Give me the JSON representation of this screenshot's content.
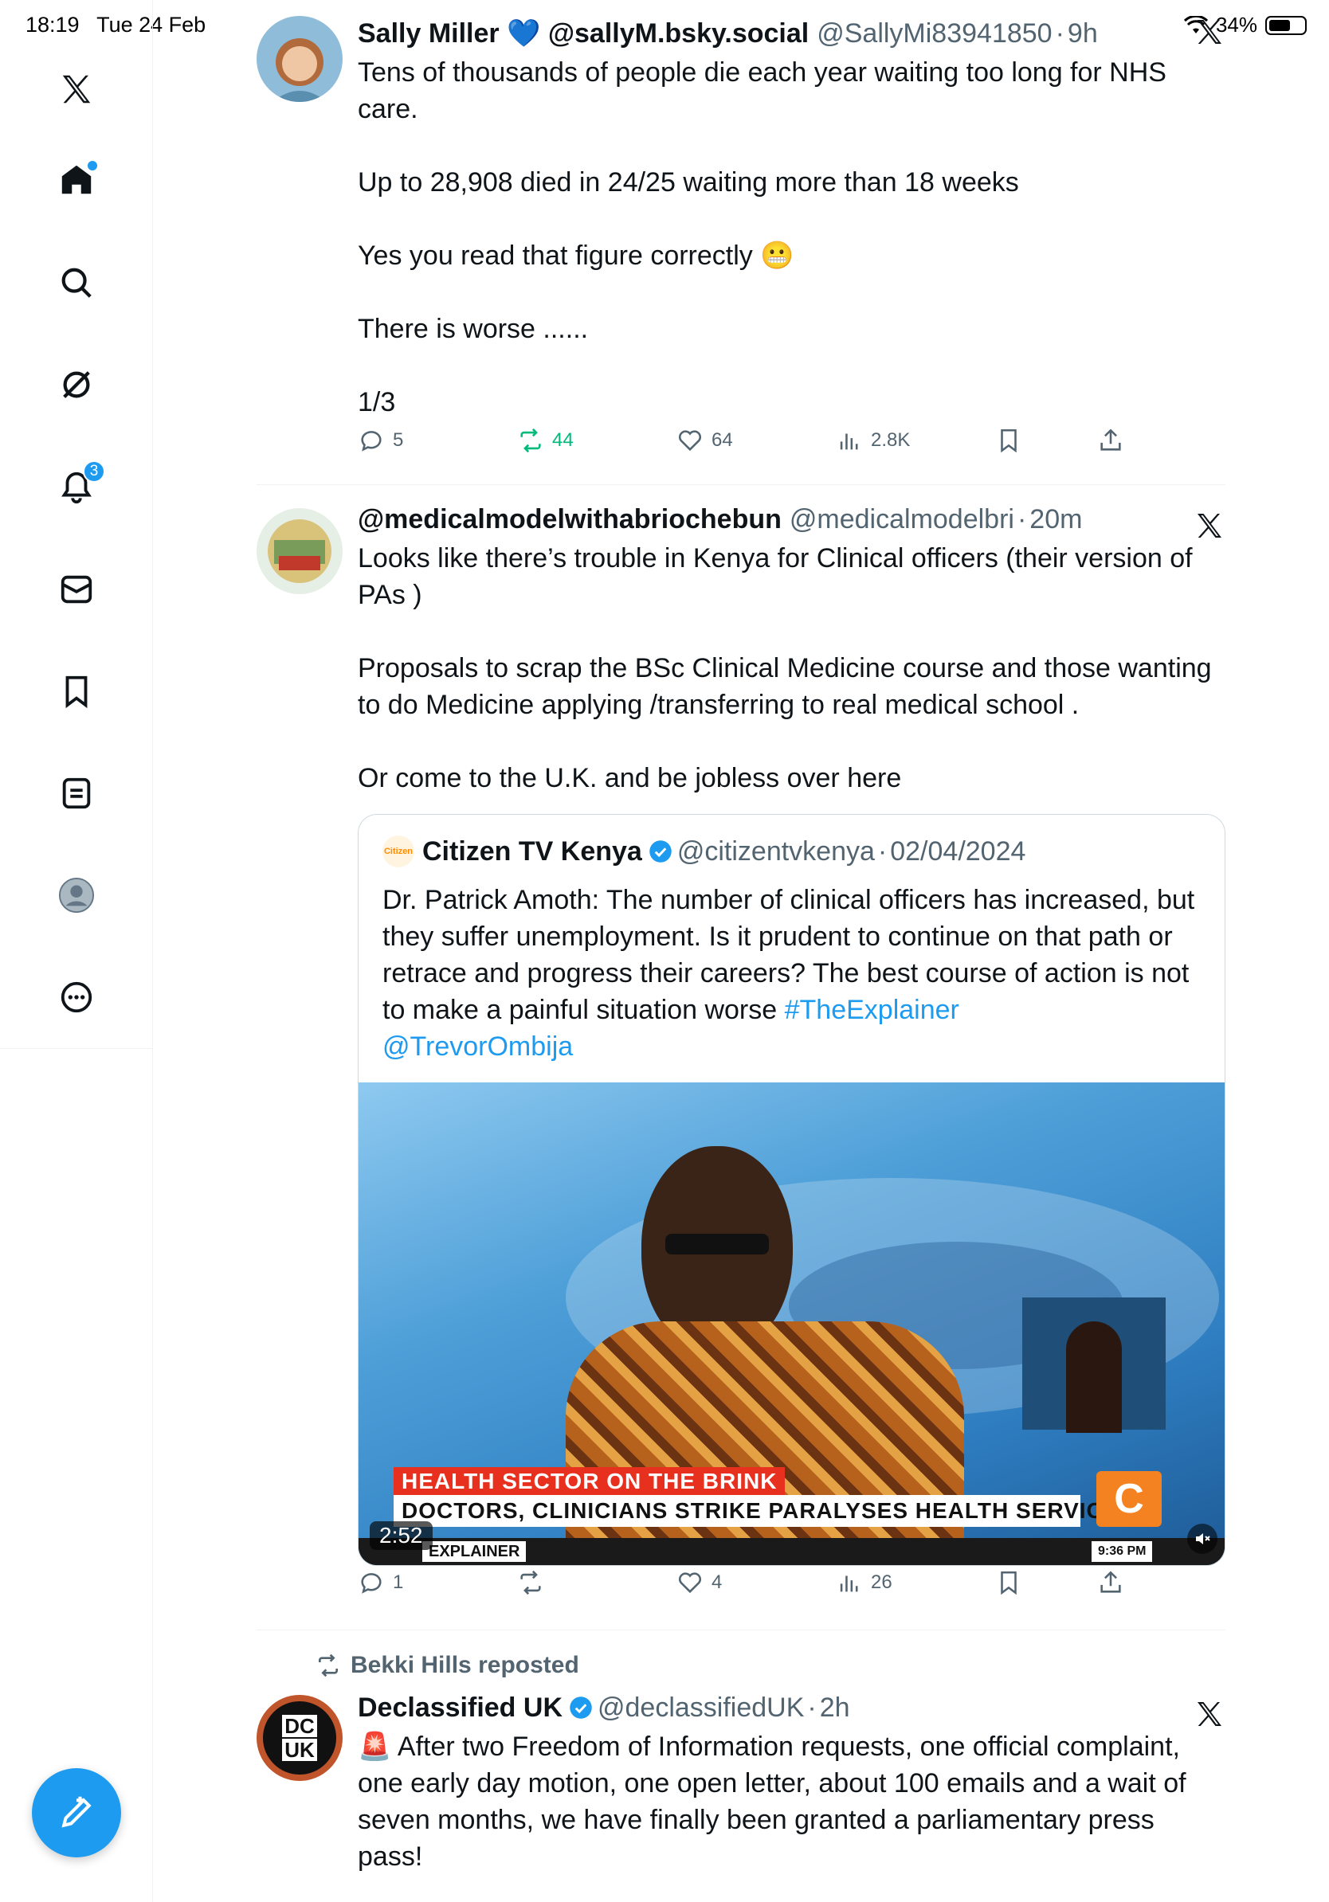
{
  "status_bar": {
    "time": "18:19",
    "date": "Tue 24 Feb",
    "battery": "34%"
  },
  "sidebar": {
    "notifications_count": "3",
    "items": [
      "home",
      "explore",
      "grok",
      "notifications",
      "messages",
      "bookmarks",
      "lists",
      "profile",
      "more"
    ]
  },
  "tweets": [
    {
      "name": "Sally Miller 💙 @sallyM.bsky.social",
      "handle": "@SallyMi83941850",
      "sep": "·",
      "time": "9h",
      "text": "Tens of thousands of people die each year waiting too long for NHS care.\n\nUp to 28,908 died in 24/25 waiting more than 18 weeks\n\nYes you read that figure correctly 😬\n\nThere is worse ......\n\n1/3",
      "replies": "5",
      "reposts": "44",
      "likes": "64",
      "views": "2.8K"
    },
    {
      "name": "@medicalmodelwithabriochebun",
      "handle": "@medicalmodelbri",
      "sep": "·",
      "time": "20m",
      "text": "Looks like there’s trouble in Kenya for Clinical officers (their version of PAs )\n\nProposals to scrap the BSc Clinical Medicine course and those wanting to do Medicine applying /transferring to real medical school .\n\nOr come to the U.K. and be jobless over here",
      "quote": {
        "name": "Citizen TV Kenya",
        "logo_text": "Citizen",
        "handle": "@citizentvkenya",
        "sep": "·",
        "date": "02/04/2024",
        "text": "Dr. Patrick Amoth: The number of clinical officers has increased, but they suffer unemployment. Is it prudent to continue on that path or retrace and progress their careers? The best course of action is not to make a painful situation worse ",
        "hashtag": "#TheExplainer",
        "mention": "@TrevorOmbija",
        "video": {
          "headline": "HEALTH SECTOR ON THE BRINK",
          "subline": "DOCTORS, CLINICIANS STRIKE PARALYSES HEALTH SERVICES",
          "ticker_label": "EXPLAINER",
          "broadcast_time": "9:36 PM",
          "duration": "2:52",
          "channel_logo": "C"
        }
      },
      "replies": "1",
      "reposts": "",
      "likes": "4",
      "views": "26"
    },
    {
      "reposted_by": "Bekki Hills reposted",
      "name": "Declassified UK",
      "handle": "@declassifiedUK",
      "sep": "·",
      "time": "2h",
      "avatar_text_top": "DC",
      "avatar_text_bottom": "UK",
      "text": "🚨 After two Freedom of Information requests, one official complaint, one early day motion, one open letter, about 100 emails and a wait of seven months, we have finally been granted a parliamentary press pass!\n\nThank you to everyone who helped us secure this major victory 👇"
    }
  ],
  "colors": {
    "accent": "#1d9bf0",
    "repost_green": "#00ba7c",
    "secondary_text": "#536471"
  }
}
